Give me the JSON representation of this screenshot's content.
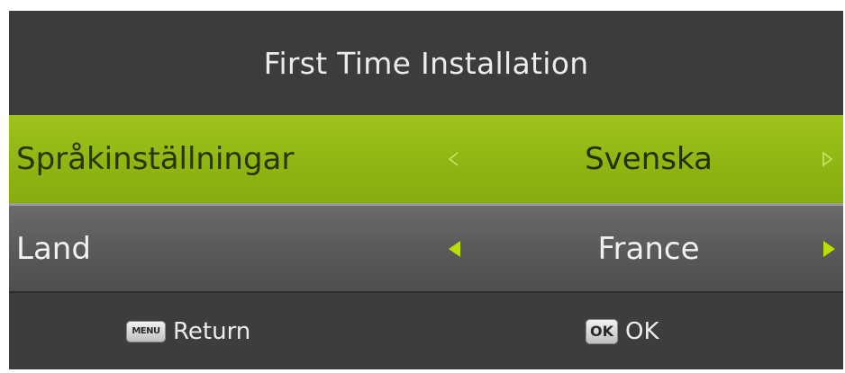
{
  "header": {
    "title": "First Time Installation"
  },
  "rows": [
    {
      "label": "Språkinställningar",
      "value": "Svenska",
      "state": "selected"
    },
    {
      "label": "Land",
      "value": "France",
      "state": "normal"
    }
  ],
  "footer": {
    "return": {
      "key": "MENU",
      "label": "Return"
    },
    "ok": {
      "key": "OK",
      "label": "OK"
    }
  },
  "colors": {
    "highlight": "#8fb612",
    "arrow_active": "#b9e000",
    "panel_background": "#3a3a3a"
  }
}
